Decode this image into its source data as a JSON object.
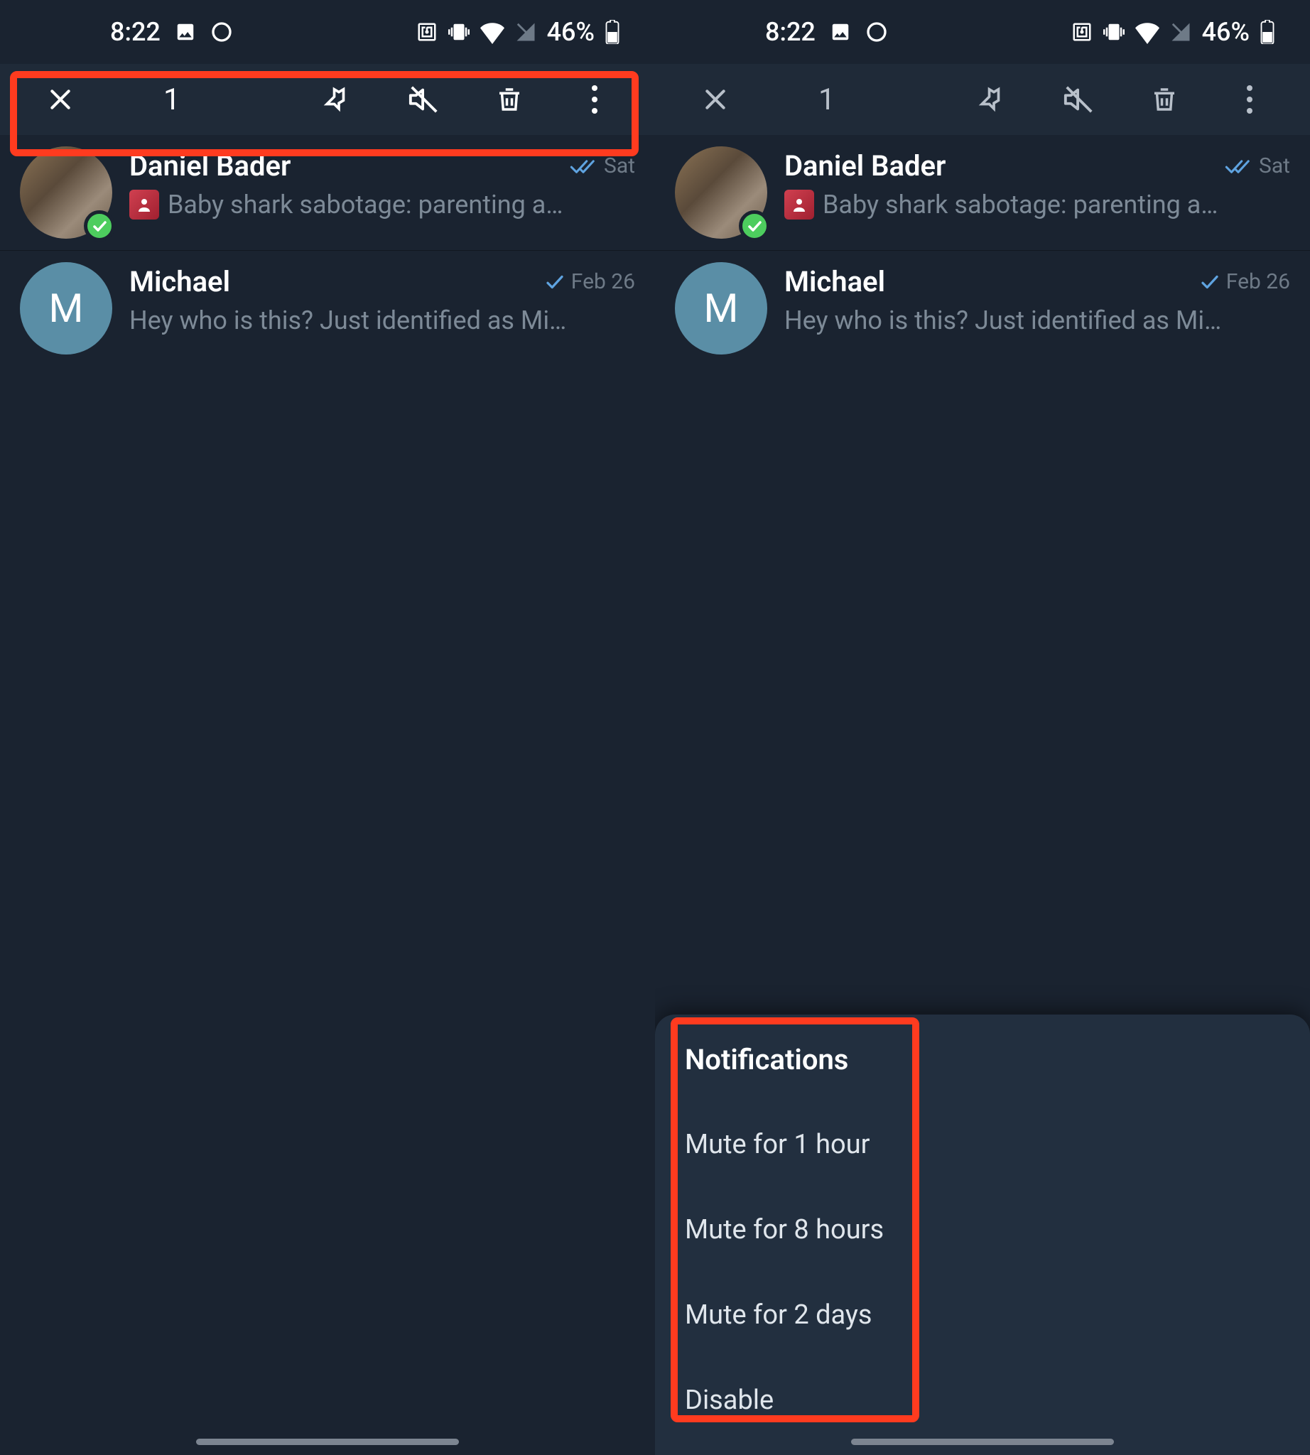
{
  "status": {
    "time": "8:22",
    "battery_pct": "46%"
  },
  "actionbar": {
    "selected_count": "1"
  },
  "chats": [
    {
      "name": "Daniel Bader",
      "preview": "Baby shark sabotage: parenting a…",
      "time": "Sat",
      "checks": "double",
      "avatar_kind": "photo",
      "initial": "",
      "has_thumb": true,
      "online": true
    },
    {
      "name": "Michael",
      "preview": "Hey who is this? Just identified as Mi…",
      "time": "Feb 26",
      "checks": "single",
      "avatar_kind": "letter",
      "initial": "M",
      "has_thumb": false,
      "online": false
    }
  ],
  "sheet": {
    "title": "Notifications",
    "items": [
      "Mute for 1 hour",
      "Mute for 8 hours",
      "Mute for 2 days",
      "Disable"
    ]
  }
}
